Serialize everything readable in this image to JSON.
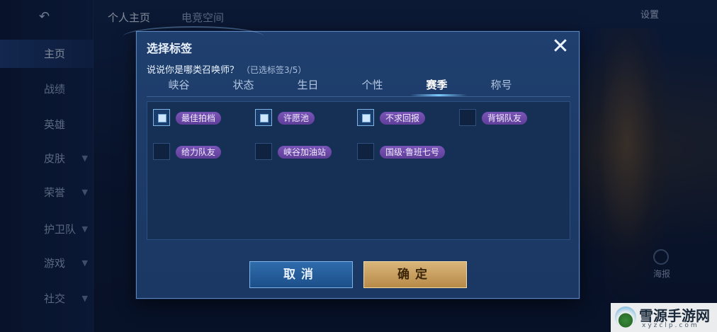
{
  "background": {
    "topbar_tabs": [
      "个人主页",
      "电竞空间"
    ],
    "settings_label": "设置",
    "share_label": "海报",
    "sidebar": [
      {
        "label": "主页",
        "active": true,
        "has_chevron": false
      },
      {
        "label": "战绩",
        "active": false,
        "has_chevron": false
      },
      {
        "label": "英雄",
        "active": false,
        "has_chevron": false
      },
      {
        "label": "皮肤",
        "active": false,
        "has_chevron": true
      },
      {
        "label": "荣誉",
        "active": false,
        "has_chevron": true
      },
      {
        "label": "护卫队",
        "active": false,
        "has_chevron": true
      },
      {
        "label": "游戏",
        "active": false,
        "has_chevron": true
      },
      {
        "label": "社交",
        "active": false,
        "has_chevron": true
      }
    ]
  },
  "modal": {
    "title": "选择标签",
    "question": "说说你是哪类召唤师？",
    "count_hint": "（已选标签3/5）",
    "tabs": [
      {
        "label": "峡谷",
        "active": false
      },
      {
        "label": "状态",
        "active": false
      },
      {
        "label": "生日",
        "active": false
      },
      {
        "label": "个性",
        "active": false
      },
      {
        "label": "赛季",
        "active": true
      },
      {
        "label": "称号",
        "active": false
      }
    ],
    "tags": [
      [
        {
          "label": "最佳拍档",
          "checked": true
        },
        {
          "label": "许愿池",
          "checked": true
        },
        {
          "label": "不求回报",
          "checked": true
        },
        {
          "label": "背锅队友",
          "checked": false
        }
      ],
      [
        {
          "label": "给力队友",
          "checked": false
        },
        {
          "label": "峡谷加油站",
          "checked": false
        },
        {
          "label": "国级·鲁班七号",
          "checked": false
        }
      ]
    ],
    "cancel_label": "取消",
    "confirm_label": "确定",
    "close_symbol": "✕"
  },
  "watermark": {
    "name": "雪源手游网",
    "url": "xyzclp.com"
  },
  "colors": {
    "tag_pill": "#6a48a8",
    "confirm": "#c99e5e",
    "cancel": "#24609d",
    "modal_bg": "#1e3c6a"
  }
}
